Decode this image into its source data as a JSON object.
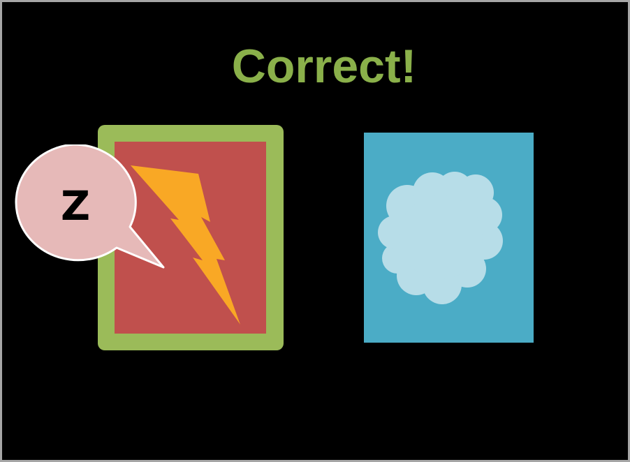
{
  "feedback": {
    "text": "Correct!",
    "color": "#8ab04a"
  },
  "choices": [
    {
      "icon": "lightning-icon",
      "background": "#c0504d",
      "icon_color": "#f9a825",
      "selected": true,
      "selection_border": "#9bbb59"
    },
    {
      "icon": "cloud-icon",
      "background": "#4bacc6",
      "icon_color": "#b7dde8",
      "selected": false
    }
  ],
  "speech_bubble": {
    "letter": "Z",
    "fill": "#e6b9b8"
  }
}
